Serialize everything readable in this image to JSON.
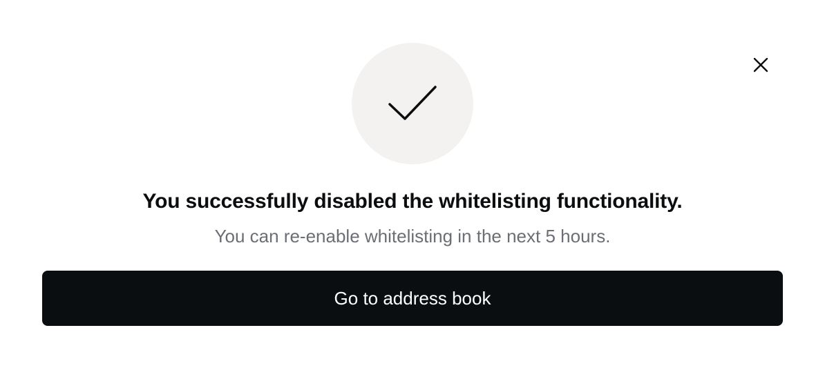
{
  "dialog": {
    "title": "You successfully disabled the whitelisting functionality.",
    "subtitle": "You can re-enable whitelisting in the next 5 hours.",
    "primary_button_label": "Go to address book",
    "close_icon": "close-icon",
    "status_icon": "checkmark-icon"
  },
  "colors": {
    "background": "#ffffff",
    "icon_circle": "#f3f2f0",
    "title_text": "#0b0d0f",
    "subtitle_text": "#6b6e73",
    "button_bg": "#0b0e11",
    "button_text": "#ffffff"
  }
}
